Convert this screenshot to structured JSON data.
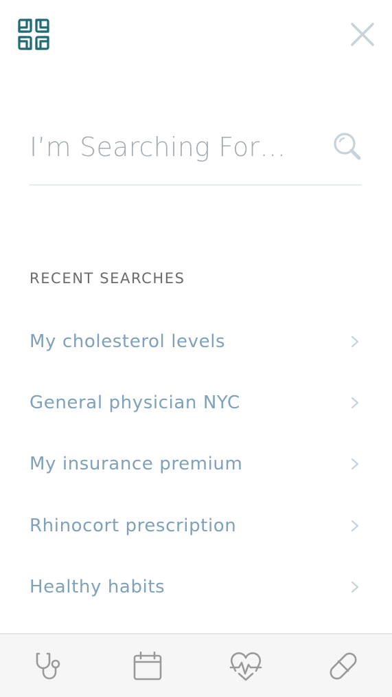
{
  "header": {
    "logo_icon": "cross-grid-logo-icon",
    "close_icon": "close-icon"
  },
  "search": {
    "placeholder": "I’m Searching For…",
    "value": "",
    "icon": "search-icon"
  },
  "recent": {
    "title": "RECENT SEARCHES",
    "items": [
      {
        "label": "My cholesterol levels"
      },
      {
        "label": "General physician NYC"
      },
      {
        "label": "My insurance premium"
      },
      {
        "label": "Rhinocort prescription"
      },
      {
        "label": "Healthy habits"
      }
    ]
  },
  "tabbar": {
    "tabs": [
      {
        "icon": "stethoscope-icon"
      },
      {
        "icon": "calendar-icon"
      },
      {
        "icon": "heart-pulse-icon"
      },
      {
        "icon": "pill-icon"
      }
    ]
  },
  "colors": {
    "brand": "#1f6b78",
    "link": "#7fa1b9",
    "muted": "#a3abb0",
    "icon_light": "#c7d2da",
    "tabbar_icon": "#9a9a9a"
  }
}
